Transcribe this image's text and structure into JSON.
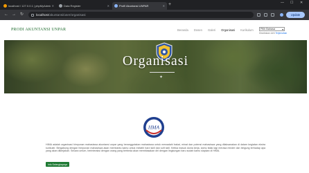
{
  "browser": {
    "tabs": [
      {
        "title": "localhost / 127.0.0.1 | phpMyAdmin",
        "active": false,
        "favicon_color": "#f29900"
      },
      {
        "title": "Data Register",
        "active": false,
        "favicon_color": "#9aa0a6"
      },
      {
        "title": "Profil Akuntansi UNPAR",
        "active": true,
        "favicon_color": "#8ab4f8"
      }
    ],
    "new_tab": "+",
    "window_controls": {
      "minimize": "—",
      "maximize": "☐",
      "close": "✕"
    },
    "nav": {
      "back": "←",
      "forward": "→",
      "reload": "↻"
    },
    "address": {
      "host": "localhost",
      "path": "/akuntansi/user/organisasi"
    },
    "update_button": "Update"
  },
  "site": {
    "brand": "PRODI AKUNTANSI UNPAR",
    "menu": [
      {
        "label": "Beranda",
        "active": false
      },
      {
        "label": "Dosen",
        "active": false
      },
      {
        "label": "Galeri",
        "active": false
      },
      {
        "label": "Organisasi",
        "active": true
      },
      {
        "label": "Kurikulum",
        "active": false
      }
    ],
    "translate": {
      "selected": "Pilih Bahasa",
      "powered_prefix": "Disediakan oleh",
      "powered_by": "Terjemahan"
    }
  },
  "hero": {
    "title": "Organisasi",
    "mark": "✦"
  },
  "content": {
    "logo_text": "HMA",
    "description": "HIMA adalah organisasi himpunan mahasiswa akuntansi unpar yang beranggotakan mahasiswa untuk mewadahi bakat, minat dan potensi mahasiswa yang dilaksanakan di dalam kegiatan ekstra kurikuler. Bergabung dengan himpunan mahasiswa akan membantu kamu untuk melatih hard skill dan soft skill. Ketika masuk dunia kerja, kamu tidak lagi merasa minder dan bingung terhadap apa yang akan dikerjakan. Secara umum, berinteraksi dengan orang yang berbeda akan membiasakan diri dengan lingkungan baru sudah kamu siapkan di HIMA.",
    "more_button": "Info Selengkapnya"
  },
  "colors": {
    "accent_green": "#1f7a34",
    "brand_green": "#1e6b2d",
    "chrome_dark": "#202124"
  }
}
